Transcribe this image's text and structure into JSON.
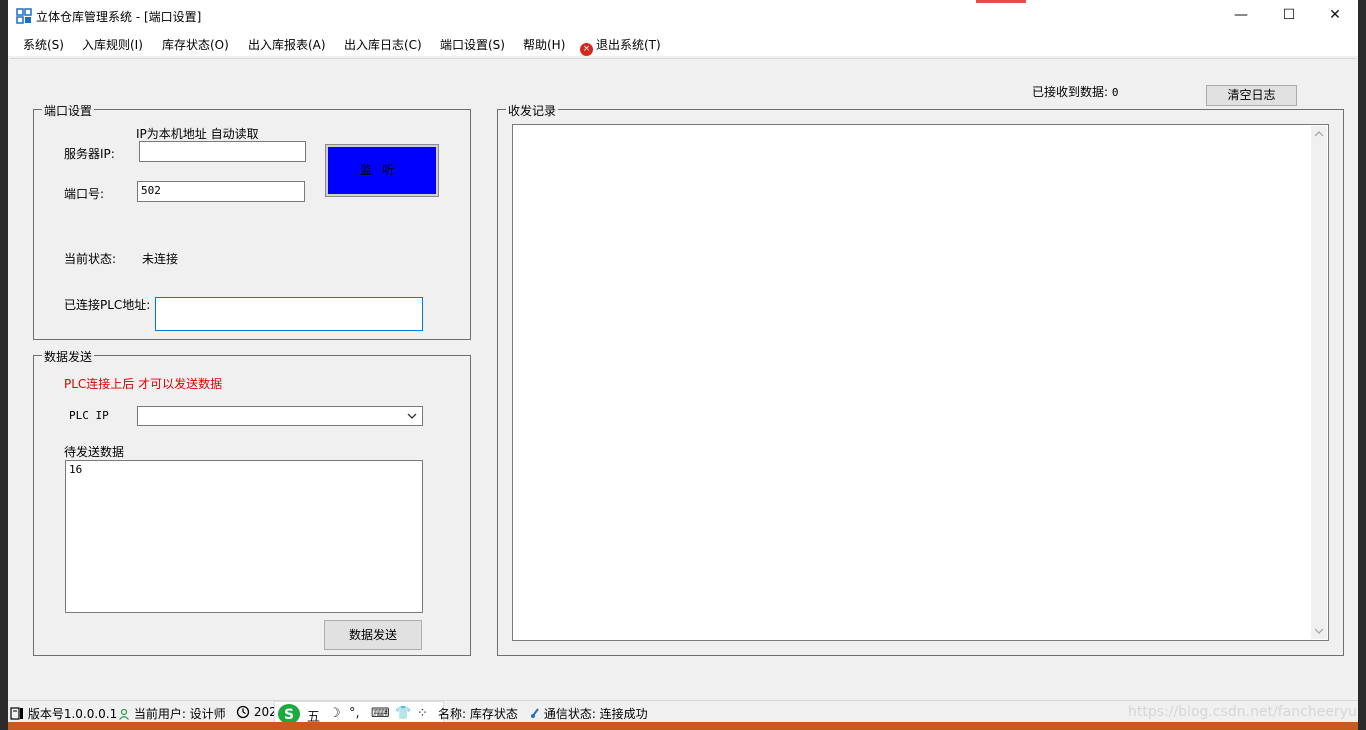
{
  "window": {
    "title": "立体仓库管理系统 - [端口设置]",
    "controls": {
      "minimize": "—",
      "maximize": "☐",
      "close": "✕"
    }
  },
  "menu": {
    "items": [
      "系统(S)",
      "入库规则(I)",
      "库存状态(O)",
      "出入库报表(A)",
      "出入库日志(C)",
      "端口设置(S)",
      "帮助(H)"
    ],
    "exit_label": "退出系统(T)"
  },
  "header": {
    "received_label": "已接收到数据:",
    "received_count": "0",
    "clear_log_label": "清空日志"
  },
  "port_settings": {
    "legend": "端口设置",
    "ip_hint": "IP为本机地址 自动读取",
    "server_ip_label": "服务器IP:",
    "server_ip_value": "",
    "port_label": "端口号:",
    "port_value": "502",
    "listen_label": "监听",
    "status_label": "当前状态:",
    "status_value": "未连接",
    "plc_addr_label": "已连接PLC地址:",
    "plc_addr_value": ""
  },
  "data_send": {
    "legend": "数据发送",
    "warning": "PLC连接上后 才可以发送数据",
    "plc_ip_label": "PLC IP",
    "plc_ip_selected": "",
    "pending_label": "待发送数据",
    "pending_value": "16",
    "send_label": "数据发送"
  },
  "log": {
    "legend": "收发记录",
    "content": ""
  },
  "statusbar": {
    "version": "版本号1.0.0.0.1",
    "user": "当前用户: 设计师",
    "time_partial": "202",
    "ime": [
      "五",
      "☽",
      "°,",
      "⌨",
      "👕",
      "⁘"
    ],
    "name": "名称: 库存状态",
    "comm_status": "通信状态: 连接成功",
    "watermark": "https://blog.csdn.net/fancheeryu"
  },
  "colors": {
    "listen_button": "#0000ff",
    "warning_text": "#e00000",
    "ime_logo": "#1aaa3e",
    "exit_icon": "#d9261c"
  }
}
